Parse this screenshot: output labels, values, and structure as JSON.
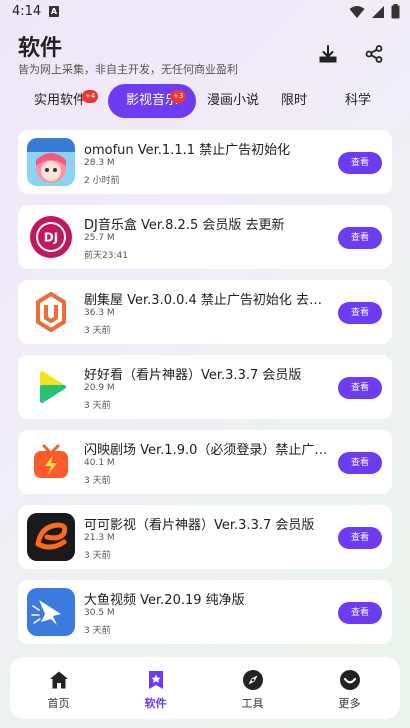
{
  "status_bar": {
    "time": "4:14"
  },
  "header": {
    "title": "软件",
    "subtitle": "皆为网上采集，非自主开发，无任何商业盈利"
  },
  "tabs": [
    {
      "label": "实用软件",
      "badge": "+4"
    },
    {
      "label": "影视音乐",
      "badge": "+3",
      "active": true
    },
    {
      "label": "漫画小说"
    },
    {
      "label": "限时"
    },
    {
      "label": "科学"
    }
  ],
  "items": [
    {
      "name": "omofun Ver.1.1.1 禁止广告初始化",
      "size": "28.3 M",
      "time": "2 小时前",
      "button": "查看",
      "icon": "omofun-anime-icon"
    },
    {
      "name": "DJ音乐盒 Ver.8.2.5 会员版 去更新",
      "size": "25.7 M",
      "time": "前天23:41",
      "button": "查看",
      "icon": "dj-music-icon"
    },
    {
      "name": "剧集屋 Ver.3.0.0.4 禁止广告初始化 去更新…",
      "size": "36.3 M",
      "time": "3 天前",
      "button": "查看",
      "icon": "jujiwu-icon"
    },
    {
      "name": "好好看（看片神器）Ver.3.3.7 会员版",
      "size": "20.9 M",
      "time": "3 天前",
      "button": "查看",
      "icon": "play-icon"
    },
    {
      "name": "闪映剧场 Ver.1.9.0（必须登录）禁止广告…",
      "size": "40.1 M",
      "time": "3 天前",
      "button": "查看",
      "icon": "tv-flash-icon"
    },
    {
      "name": "可可影视（看片神器）Ver.3.3.7 会员版",
      "size": "21.3 M",
      "time": "3 天前",
      "button": "查看",
      "icon": "keke-icon"
    },
    {
      "name": "大鱼视频 Ver.20.19 纯净版",
      "size": "30.5 M",
      "time": "3 天前",
      "button": "查看",
      "icon": "fish-icon"
    }
  ],
  "bottom_nav": [
    {
      "label": "首页",
      "icon": "home-icon"
    },
    {
      "label": "软件",
      "icon": "software-icon",
      "active": true
    },
    {
      "label": "工具",
      "icon": "compass-icon"
    },
    {
      "label": "更多",
      "icon": "more-icon"
    }
  ],
  "colors": {
    "accent": "#6d3bf2",
    "badge": "#e53935"
  }
}
